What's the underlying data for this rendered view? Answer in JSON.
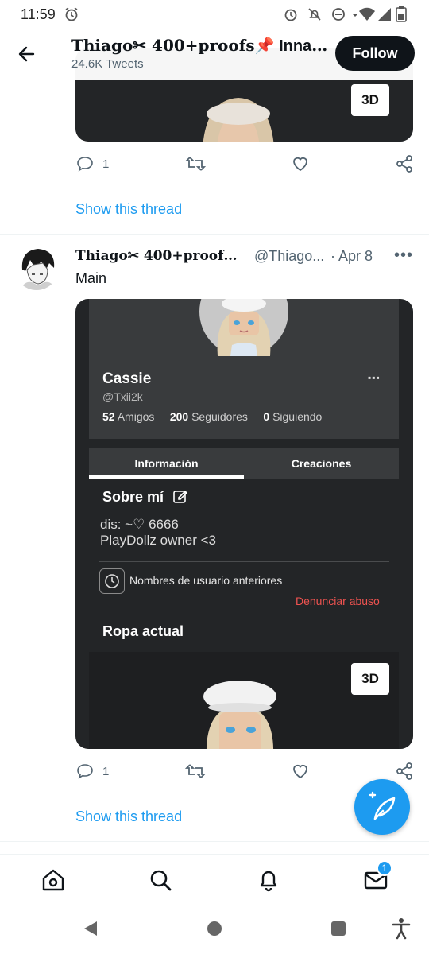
{
  "status_bar": {
    "time": "11:59"
  },
  "header": {
    "title_name": "Thiago✂ 400+proofs",
    "title_suffix": "📌 Innact...",
    "tweet_count": "24.6K Tweets",
    "follow_label": "Follow"
  },
  "tweet1": {
    "media_badge": "3D",
    "reply_count": "1",
    "show_thread": "Show this thread"
  },
  "tweet2": {
    "name": "Thiago✂ 400+proofs...",
    "handle": "@Thiago...",
    "date": "· Apr 8",
    "more": "•••",
    "text": "Main",
    "reply_count": "1",
    "show_thread": "Show this thread",
    "media": {
      "profile_name": "Cassie",
      "profile_handle": "@Txii2k",
      "friends_count": "52",
      "friends_label": "Amigos",
      "followers_count": "200",
      "followers_label": "Seguidores",
      "following_count": "0",
      "following_label": "Siguiendo",
      "tab_info": "Información",
      "tab_creations": "Creaciones",
      "about_title": "Sobre mí",
      "bio_line1": "dis: ~♡ 6666",
      "bio_line2": "PlayDollz owner <3",
      "previous_names": "Nombres de usuario anteriores",
      "report": "Denunciar abuso",
      "outfit_title": "Ropa actual",
      "badge_3d": "3D"
    }
  },
  "bottom_nav": {
    "messages_badge": "1"
  },
  "colors": {
    "accent": "#1d9bf0",
    "text": "#0f1419",
    "muted": "#536471",
    "card_bg": "#232527",
    "report_red": "#ef5350"
  }
}
